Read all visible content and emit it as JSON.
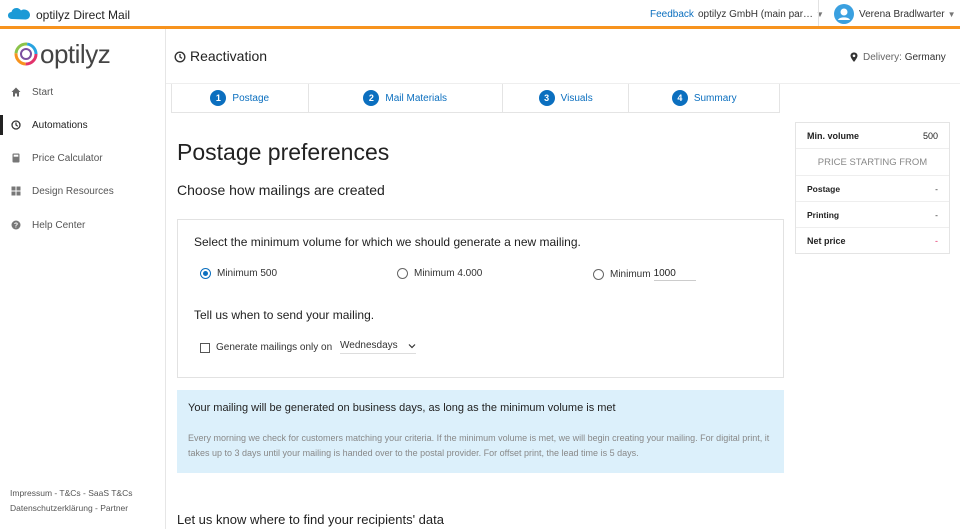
{
  "topbar": {
    "app_name": "optilyz Direct Mail",
    "feedback": "Feedback",
    "org": "optilyz GmbH (main par…",
    "user": "Verena Bradlwarter"
  },
  "sidebar": {
    "logo": "optilyz",
    "items": [
      {
        "label": "Start",
        "icon": "home-icon"
      },
      {
        "label": "Automations",
        "icon": "clock-icon",
        "active": true
      },
      {
        "label": "Price Calculator",
        "icon": "calculator-icon"
      },
      {
        "label": "Design Resources",
        "icon": "grid-icon"
      },
      {
        "label": "Help Center",
        "icon": "help-icon"
      }
    ],
    "footer_line1": "Impressum - T&Cs - SaaS T&Cs",
    "footer_line2": "Datenschutzerklärung - Partner"
  },
  "header": {
    "title": "Reactivation",
    "delivery_label": "Delivery:",
    "delivery_value": "Germany"
  },
  "steps": [
    {
      "num": "1",
      "label": "Postage"
    },
    {
      "num": "2",
      "label": "Mail Materials"
    },
    {
      "num": "3",
      "label": "Visuals"
    },
    {
      "num": "4",
      "label": "Summary"
    }
  ],
  "main": {
    "title": "Postage preferences",
    "subtitle": "Choose how mailings are created",
    "volume_question": "Select the minimum volume for which we should generate a new mailing.",
    "options": [
      {
        "label": "Minimum 500",
        "selected": true
      },
      {
        "label": "Minimum 4.000",
        "selected": false
      },
      {
        "label": "Minimum",
        "value": "1000",
        "selected": false
      }
    ],
    "send_question": "Tell us when to send your mailing.",
    "checkbox_label": "Generate mailings only on",
    "day_select": "Wednesdays",
    "info_title": "Your mailing will be generated on business days, as long as the minimum volume is met",
    "info_body": "Every morning we check for customers matching your criteria. If the minimum volume is met, we will begin creating your mailing. For digital print, it takes up to 3 days until your mailing is handed over to the postal provider. For offset print, the lead time is 5 days.",
    "next_section": "Let us know where to find your recipients' data"
  },
  "summary": {
    "min_volume_label": "Min. volume",
    "min_volume_value": "500",
    "price_caption": "PRICE STARTING FROM",
    "postage_label": "Postage",
    "postage_value": "-",
    "printing_label": "Printing",
    "printing_value": "-",
    "net_label": "Net price",
    "net_value": "-"
  },
  "colors": {
    "accent": "#0b6fbf",
    "topbar_border": "#f7931e",
    "info_bg": "#dcf0fb"
  }
}
